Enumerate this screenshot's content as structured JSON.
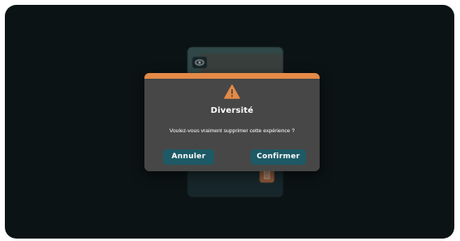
{
  "background_card": {
    "eye_icon": "eye-icon",
    "trash_icon": "trash-icon"
  },
  "modal": {
    "accent_color": "#e58a47",
    "icon": "warning-icon",
    "title": "Diversité",
    "message": "Voulez-vous vraiment supprimer cette expérience ?",
    "cancel_label": "Annuler",
    "confirm_label": "Confirmer",
    "button_color": "#1d5a66"
  }
}
